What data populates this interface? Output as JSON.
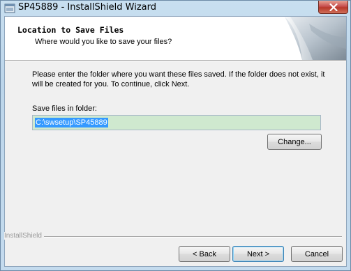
{
  "window": {
    "title": "SP45889 - InstallShield Wizard"
  },
  "header": {
    "title": "Location to Save Files",
    "subtitle": "Where would you like to save your files?"
  },
  "body": {
    "instruction": "Please enter the folder where you want these files saved.  If the folder does not exist, it will be created for you.   To continue, click Next.",
    "folder_label": "Save files in folder:",
    "folder_value": "C:\\swsetup\\SP45889",
    "change_label": "Change..."
  },
  "footer": {
    "brand": "InstallShield",
    "back_label": "< Back",
    "next_label": "Next >",
    "cancel_label": "Cancel"
  },
  "colors": {
    "title_bar": "#c4dbee",
    "close_button": "#c75050",
    "selection": "#3399ff",
    "input_background": "#cfe9cf"
  },
  "icons": {
    "app": "installshield-app-icon",
    "close": "close-icon",
    "header_graphic": "wizard-page-curl-graphic"
  }
}
